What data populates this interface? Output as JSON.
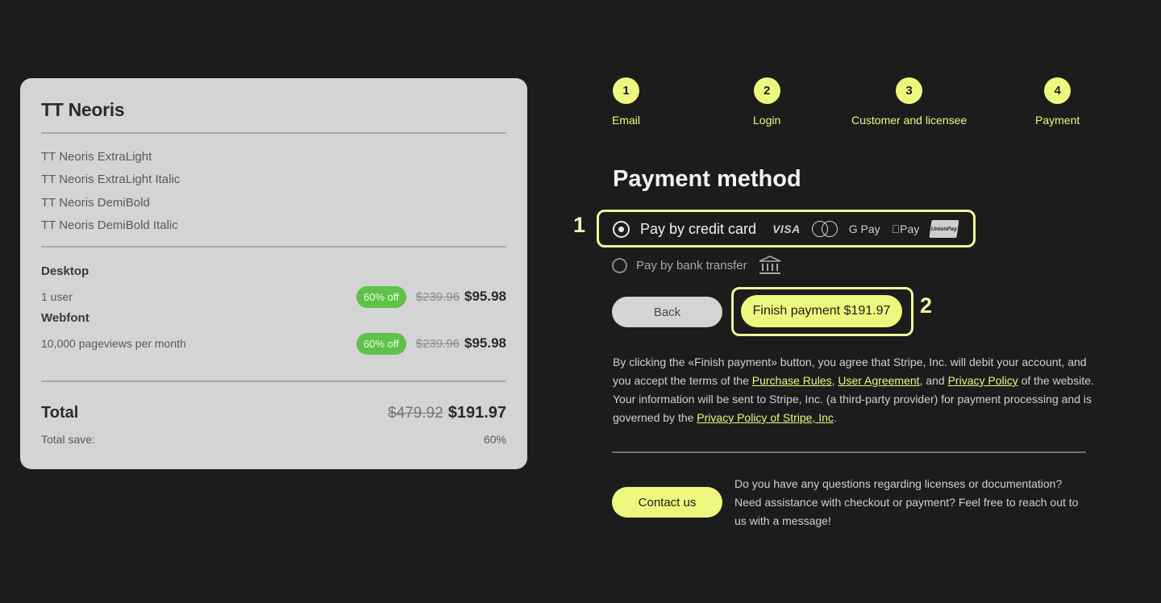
{
  "order": {
    "product_title": "TT Neoris",
    "styles": [
      "TT Neoris ExtraLight",
      "TT Neoris ExtraLight Italic",
      "TT Neoris DemiBold",
      "TT Neoris DemiBold Italic"
    ],
    "licenses": [
      {
        "section": "Desktop",
        "detail": "1 user",
        "discount": "60% off",
        "old_price": "$239.96",
        "price": "$95.98"
      },
      {
        "section": "Webfont",
        "detail": "10,000 pageviews per month",
        "discount": "60% off",
        "old_price": "$239.96",
        "price": "$95.98"
      }
    ],
    "total_label": "Total",
    "total_old": "$479.92",
    "total": "$191.97",
    "save_label": "Total save:",
    "save_value": "60%"
  },
  "steps": [
    {
      "number": "1",
      "label": "Email"
    },
    {
      "number": "2",
      "label": "Login"
    },
    {
      "number": "3",
      "label": "Customer and licensee"
    },
    {
      "number": "4",
      "label": "Payment"
    }
  ],
  "payment": {
    "heading": "Payment method",
    "option_card": "Pay by credit card",
    "option_bank": "Pay by bank transfer",
    "card_brands": [
      "VISA",
      "G Pay",
      "Pay",
      "UnionPay"
    ],
    "selected": "card"
  },
  "actions": {
    "back": "Back",
    "finish": "Finish payment $191.97"
  },
  "annotations": {
    "one": "1",
    "two": "2"
  },
  "legal": {
    "part1": "By clicking the «Finish payment» button, you agree that Stripe, Inc. will debit your account, and you accept the terms of the ",
    "link_purchase": "Purchase Rules",
    "sep1": ", ",
    "link_user": "User Agreement",
    "sep2": ", and ",
    "link_privacy": "Privacy Policy",
    "part2": " of the website. Your information will be sent to Stripe, Inc. (a third-party provider) for payment processing and is governed by the ",
    "link_stripe": "Privacy Policy of Stripe, Inc",
    "part3": "."
  },
  "contact": {
    "button": "Contact us",
    "text": "Do you have any questions regarding licenses or documentation? Need assistance with checkout or payment? Feel free to reach out to us with a message!"
  },
  "colors": {
    "background": "#1c1c1c",
    "accent": "#eef77d",
    "card": "#d4d4d4",
    "discount_badge": "#5ec24b"
  }
}
